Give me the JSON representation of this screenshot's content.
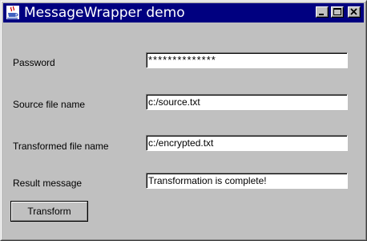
{
  "window": {
    "title": "MessageWrapper demo",
    "app_icon": "java-cup-icon",
    "controls": {
      "minimize": "minimize-icon",
      "maximize": "maximize-icon",
      "close": "close-icon"
    },
    "colors": {
      "titlebar": "#000080",
      "face": "#c0c0c0",
      "field_bg": "#ffffff"
    }
  },
  "form": {
    "password": {
      "label": "Password",
      "value": "**************"
    },
    "source": {
      "label": "Source file name",
      "value": "c:/source.txt"
    },
    "transformed": {
      "label": "Transformed file name",
      "value": "c:/encrypted.txt"
    },
    "result": {
      "label": "Result message",
      "value": "Transformation is complete!"
    }
  },
  "actions": {
    "transform_label": "Transform"
  }
}
